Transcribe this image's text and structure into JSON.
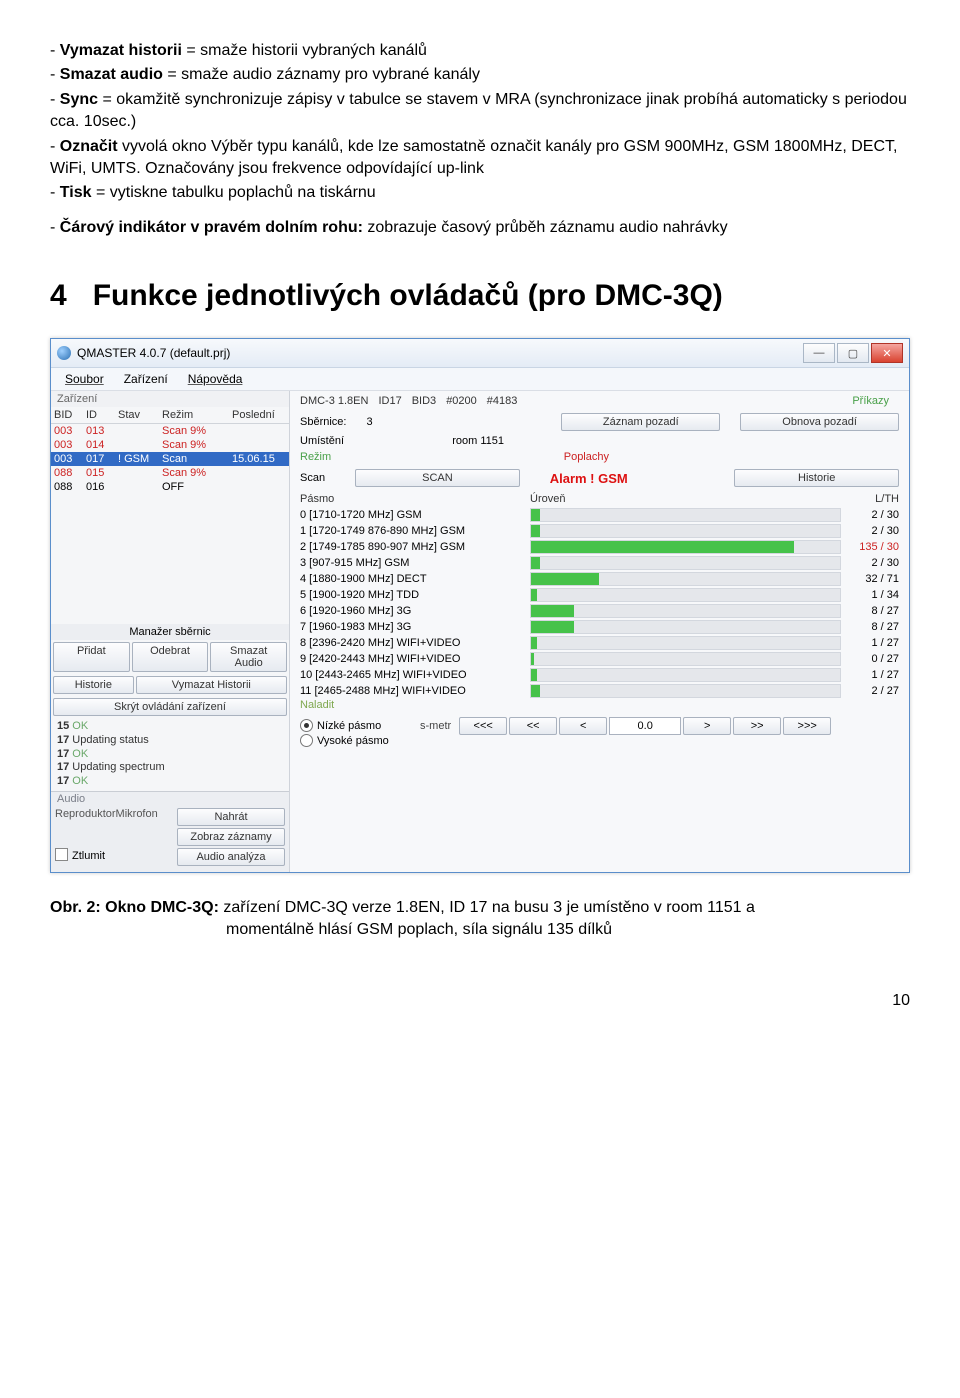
{
  "intro": {
    "l1a": "- ",
    "l1b": "Vymazat historii",
    "l1c": " = smaže historii vybraných kanálů",
    "l2a": "- ",
    "l2b": "Smazat audio",
    "l2c": " = smaže audio záznamy pro vybrané kanály",
    "l3a": "- ",
    "l3b": "Sync",
    "l3c": " = okamžitě synchronizuje zápisy v tabulce se stavem v MRA (synchronizace jinak probíhá automaticky s periodou cca. 10sec.)",
    "l4a": "- ",
    "l4b": "Označit",
    "l4c": "  vyvolá okno Výběr typu kanálů, kde lze samostatně označit kanály pro GSM 900MHz, GSM 1800MHz, DECT, WiFi, UMTS. Označovány jsou frekvence odpovídající up-link",
    "l5a": "- ",
    "l5b": "Tisk",
    "l5c": " = vytiskne tabulku poplachů na tiskárnu",
    "l6a": "- ",
    "l6b": "Čárový indikátor v pravém dolním rohu:",
    "l6c": " zobrazuje časový průběh záznamu audio nahrávky"
  },
  "section": {
    "num": "4",
    "title": "Funkce jednotlivých ovládačů  (pro DMC-3Q)"
  },
  "window": {
    "title": "QMASTER 4.0.7 (default.prj)",
    "menu": {
      "soubor": "Soubor",
      "zarizeni": "Zařízení",
      "napoveda": "Nápověda"
    }
  },
  "left": {
    "group": "Zařízení",
    "head": {
      "bid": "BID",
      "id": "ID",
      "stav": "Stav",
      "rezim": "Režim",
      "posledni": "Poslední"
    },
    "rows": [
      {
        "bid": "003",
        "id": "013",
        "stav": "",
        "rezim": "Scan 9%",
        "posledni": "",
        "cls": "red"
      },
      {
        "bid": "003",
        "id": "014",
        "stav": "",
        "rezim": "Scan 9%",
        "posledni": "",
        "cls": "red"
      },
      {
        "bid": "003",
        "id": "017",
        "stav": "! GSM",
        "rezim": "Scan",
        "posledni": "15.06.15",
        "cls": "sel"
      },
      {
        "bid": "088",
        "id": "015",
        "stav": "",
        "rezim": "Scan 9%",
        "posledni": "",
        "cls": "red"
      },
      {
        "bid": "088",
        "id": "016",
        "stav": "",
        "rezim": "OFF",
        "posledni": "",
        "cls": ""
      }
    ],
    "mgr": "Manažer sběrnic",
    "btns": {
      "pridat": "Přidat",
      "odebrat": "Odebrat",
      "smazat": "Smazat Audio",
      "historie": "Historie",
      "vymazat": "Vymazat Historii",
      "skryt": "Skrýt ovládání zařízení"
    },
    "status": [
      {
        "n": "15",
        "t": "OK",
        "ok": true
      },
      {
        "n": "17",
        "t": "Updating status",
        "ok": false
      },
      {
        "n": "17",
        "t": "OK",
        "ok": true
      },
      {
        "n": "17",
        "t": "Updating spectrum",
        "ok": false
      },
      {
        "n": "17",
        "t": "OK",
        "ok": true
      }
    ],
    "audio": {
      "hdr": "Audio",
      "rep": "Reproduktor",
      "mik": "Mikrofon",
      "nahrat": "Nahrát",
      "zobraz": "Zobraz záznamy",
      "ztlumit": "Ztlumit",
      "analyza": "Audio analýza"
    }
  },
  "right": {
    "info": {
      "device": "DMC-3 1.8EN",
      "id": "ID17",
      "bid": "BID3",
      "h1": "#0200",
      "h2": "#4183"
    },
    "prikazy": "Příkazy",
    "btn_zaznam": "Záznam pozadí",
    "btn_obnova": "Obnova pozadí",
    "sbernice_k": "Sběrnice:",
    "sbernice_v": "3",
    "umisteni_k": "Umístění",
    "umisteni_v": "room 1151",
    "rezim": "Režim",
    "poplachy": "Poplachy",
    "scan": "Scan",
    "scan_btn": "SCAN",
    "alarm": "Alarm ! GSM",
    "historie": "Historie",
    "head": {
      "pasmo": "Pásmo",
      "uroven": "Úroveň",
      "lth": "L/TH"
    },
    "bands": [
      {
        "label": "0 [1710-1720 MHz]  GSM",
        "pct": 3,
        "lth": "2 / 30"
      },
      {
        "label": "1 [1720-1749 876-890 MHz]  GSM",
        "pct": 3,
        "lth": "2 / 30"
      },
      {
        "label": "2 [1749-1785 890-907 MHz]  GSM",
        "pct": 85,
        "lth": "135 / 30",
        "red": true
      },
      {
        "label": "3 [907-915 MHz]  GSM",
        "pct": 3,
        "lth": "2 / 30"
      },
      {
        "label": "4 [1880-1900 MHz]  DECT",
        "pct": 22,
        "lth": "32 / 71"
      },
      {
        "label": "5 [1900-1920 MHz]  TDD",
        "pct": 2,
        "lth": "1 / 34"
      },
      {
        "label": "6 [1920-1960 MHz]  3G",
        "pct": 14,
        "lth": "8 / 27"
      },
      {
        "label": "7 [1960-1983 MHz]  3G",
        "pct": 14,
        "lth": "8 / 27"
      },
      {
        "label": "8 [2396-2420 MHz]  WIFI+VIDEO",
        "pct": 2,
        "lth": "1 / 27"
      },
      {
        "label": "9 [2420-2443 MHz]  WIFI+VIDEO",
        "pct": 1,
        "lth": "0 / 27"
      },
      {
        "label": "10 [2443-2465 MHz]  WIFI+VIDEO",
        "pct": 2,
        "lth": "1 / 27"
      },
      {
        "label": "11 [2465-2488 MHz]  WIFI+VIDEO",
        "pct": 3,
        "lth": "2 / 27"
      }
    ],
    "nalada": "Naladit",
    "radio_nizke": "Nízké pásmo",
    "radio_vysoke": "Vysoké pásmo",
    "smeter": "s-metr",
    "s_lll": "<<<",
    "s_ll": "<<",
    "s_l": "<",
    "s_val": "0.0",
    "s_r": ">",
    "s_rr": ">>",
    "s_rrr": ">>>"
  },
  "caption": {
    "a": "Obr. 2: Okno DMC-3Q:",
    "b": "  zařízení DMC-3Q verze 1.8EN, ID 17 na busu 3 je umístěno v room 1151 a",
    "c": "momentálně hlásí GSM poplach, síla signálu 135 dílků"
  },
  "page": "10"
}
